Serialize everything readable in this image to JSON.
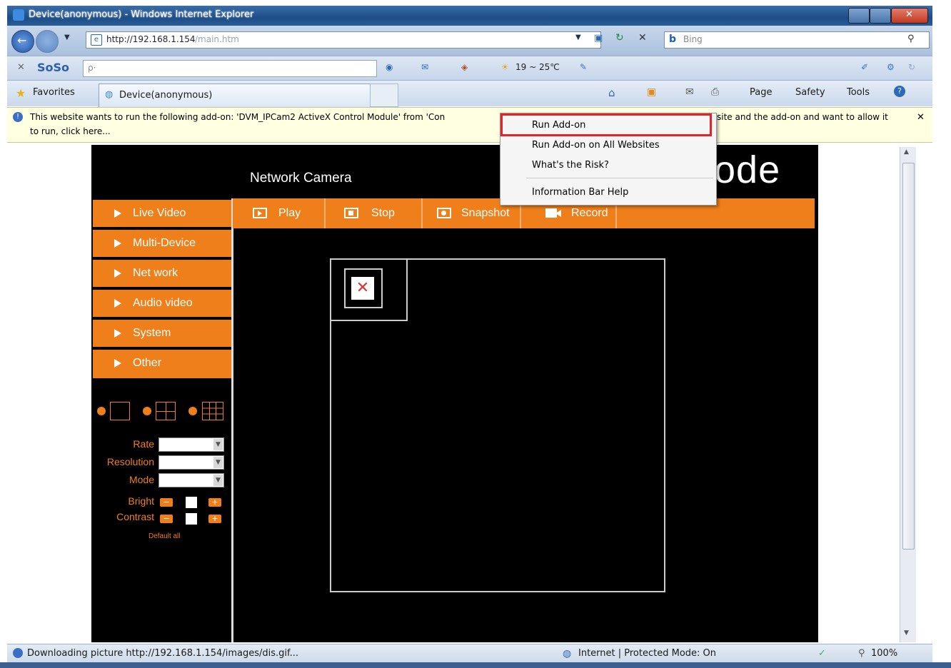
{
  "window": {
    "title": "Device(anonymous) - Windows Internet Explorer"
  },
  "address": {
    "url_host": "http://192.168.1.154",
    "url_path": "/main.htm",
    "search_placeholder": "Bing"
  },
  "soso": {
    "name": "SoSo",
    "search_placeholder": "ρ·",
    "weather": "19 ~ 25℃"
  },
  "favbar": {
    "favorites": "Favorites",
    "tab_title": "Device(anonymous)",
    "page_label": "Page",
    "safety_label": "Safety",
    "tools_label": "Tools"
  },
  "infobar": {
    "line1_left": "This website wants to run the following add-on: 'DVM_IPCam2 ActiveX Control Module' from 'Con",
    "line1_right": "site and the add-on and want to allow it",
    "line2": "to run, click here...",
    "close": "✕"
  },
  "context_menu": {
    "items": [
      "Run Add-on",
      "Run Add-on on All Websites",
      "What's the Risk?",
      "Information Bar Help"
    ]
  },
  "camera": {
    "title": "Network Camera",
    "logo_partial": "ode",
    "menu": [
      "Live Video",
      "Multi-Device",
      "Net work",
      "Audio video",
      "System",
      "Other"
    ],
    "toolbar": [
      "Play",
      "Stop",
      "Snapshot",
      "Record"
    ],
    "controls": {
      "rate": "Rate",
      "resolution": "Resolution",
      "mode": "Mode",
      "bright": "Bright",
      "contrast": "Contrast",
      "default_all": "Default all"
    }
  },
  "statusbar": {
    "left": "Downloading picture http://192.168.1.154/images/dis.gif...",
    "zone": "Internet | Protected Mode: On",
    "zoom": "100%"
  },
  "colors": {
    "accent_orange": "#ef7f1a",
    "highlight_red": "#e0242a",
    "ie_blue": "#1d4c86"
  }
}
